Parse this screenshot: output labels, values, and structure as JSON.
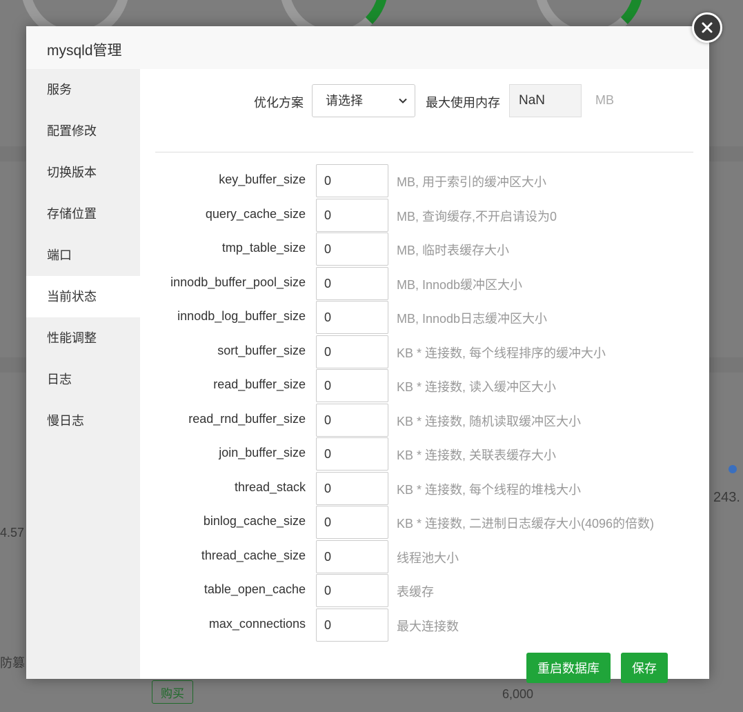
{
  "background": {
    "values": [
      "4.57",
      "243.",
      "6,000"
    ],
    "partial_text": "防篡",
    "buy_label": "购买"
  },
  "modal": {
    "title": "mysqld管理",
    "sidebar": {
      "items": [
        {
          "label": "服务"
        },
        {
          "label": "配置修改"
        },
        {
          "label": "切换版本"
        },
        {
          "label": "存储位置"
        },
        {
          "label": "端口"
        },
        {
          "label": "当前状态"
        },
        {
          "label": "性能调整"
        },
        {
          "label": "日志"
        },
        {
          "label": "慢日志"
        }
      ],
      "active_index": 5
    },
    "optimize": {
      "label": "优化方案",
      "select_value": "请选择",
      "max_mem_label": "最大使用内存",
      "max_mem_value": "NaN",
      "unit": "MB"
    },
    "params": [
      {
        "name": "key_buffer_size",
        "value": "0",
        "help": "MB, 用于索引的缓冲区大小"
      },
      {
        "name": "query_cache_size",
        "value": "0",
        "help": "MB, 查询缓存,不开启请设为0"
      },
      {
        "name": "tmp_table_size",
        "value": "0",
        "help": "MB, 临时表缓存大小"
      },
      {
        "name": "innodb_buffer_pool_size",
        "value": "0",
        "help": "MB, Innodb缓冲区大小"
      },
      {
        "name": "innodb_log_buffer_size",
        "value": "0",
        "help": "MB, Innodb日志缓冲区大小"
      },
      {
        "name": "sort_buffer_size",
        "value": "0",
        "help": "KB * 连接数, 每个线程排序的缓冲大小"
      },
      {
        "name": "read_buffer_size",
        "value": "0",
        "help": "KB * 连接数, 读入缓冲区大小"
      },
      {
        "name": "read_rnd_buffer_size",
        "value": "0",
        "help": "KB * 连接数, 随机读取缓冲区大小"
      },
      {
        "name": "join_buffer_size",
        "value": "0",
        "help": "KB * 连接数, 关联表缓存大小"
      },
      {
        "name": "thread_stack",
        "value": "0",
        "help": "KB * 连接数, 每个线程的堆栈大小"
      },
      {
        "name": "binlog_cache_size",
        "value": "0",
        "help": "KB * 连接数, 二进制日志缓存大小(4096的倍数)"
      },
      {
        "name": "thread_cache_size",
        "value": "0",
        "help": "线程池大小"
      },
      {
        "name": "table_open_cache",
        "value": "0",
        "help": "表缓存"
      },
      {
        "name": "max_connections",
        "value": "0",
        "help": "最大连接数"
      }
    ],
    "buttons": {
      "restart_label": "重启数据库",
      "save_label": "保存"
    },
    "colors": {
      "accent": "#20a53a",
      "sidebar_bg": "#f0f0f0",
      "header_bg": "#f8f8f8"
    }
  }
}
